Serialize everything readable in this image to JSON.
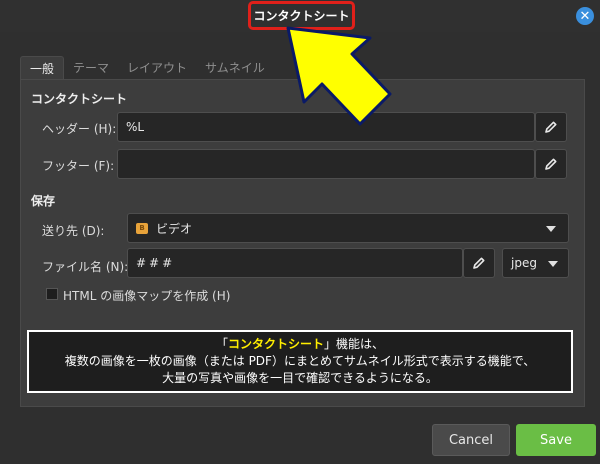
{
  "window": {
    "title": "コンタクトシート",
    "close_glyph": "✕"
  },
  "tabs": [
    {
      "label": "一般",
      "active": true
    },
    {
      "label": "テーマ",
      "active": false
    },
    {
      "label": "レイアウト",
      "active": false
    },
    {
      "label": "サムネイル",
      "active": false
    }
  ],
  "contact_sheet": {
    "section_title": "コンタクトシート",
    "header_label": "ヘッダー (H):",
    "header_value": "%L",
    "footer_label": "フッター (F):",
    "footer_value": ""
  },
  "save": {
    "section_title": "保存",
    "destination_label": "送り先 (D):",
    "destination_value": "ビデオ",
    "filename_label": "ファイル名 (N):",
    "filename_value": "###",
    "format_value": "jpeg",
    "imagemap_label": "HTML の画像マップを作成 (H)",
    "imagemap_checked": false
  },
  "annotation": {
    "open_quote": "「",
    "highlight": "コンタクトシート",
    "close_quote": "」",
    "line1_rest": "機能は、",
    "line2": "複数の画像を一枚の画像（または PDF）にまとめてサムネイル形式で表示する機能で、",
    "line3": "大量の写真や画像を一目で確認できるようになる。"
  },
  "buttons": {
    "cancel": "Cancel",
    "save": "Save"
  },
  "colors": {
    "accent_red": "#e0201a",
    "arrow_yellow": "#ffff00",
    "save_green": "#6abe45",
    "close_blue": "#3a8fdd"
  }
}
